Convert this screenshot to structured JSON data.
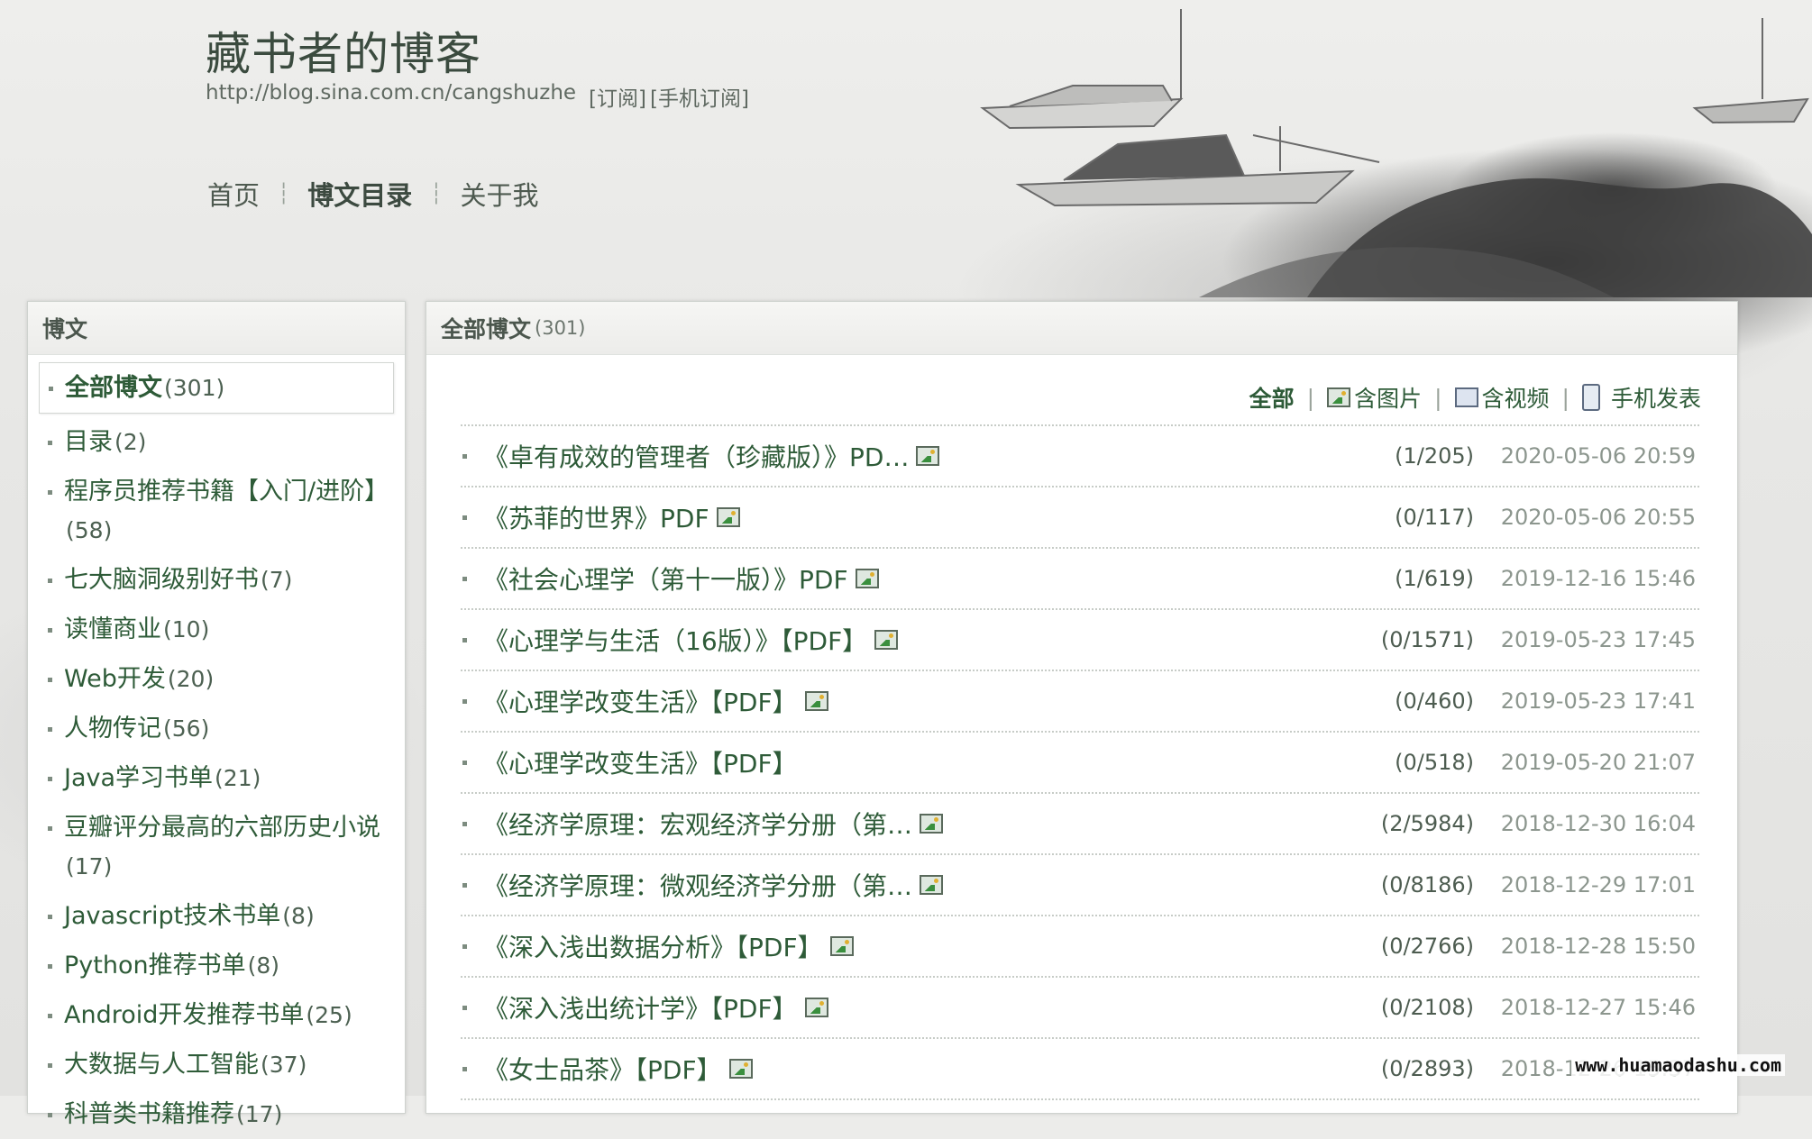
{
  "header": {
    "blog_title": "藏书者的博客",
    "url": "http://blog.sina.com.cn/cangshuzhe",
    "subscribe": "[订阅]",
    "mobile_subscribe": "[手机订阅]"
  },
  "nav": {
    "items": [
      "首页",
      "博文目录",
      "关于我"
    ],
    "active": "博文目录"
  },
  "sidebar": {
    "title": "博文",
    "categories": [
      {
        "name": "全部博文",
        "count": "(301)"
      },
      {
        "name": "目录",
        "count": "(2)"
      },
      {
        "name": "程序员推荐书籍【入门/进阶】",
        "count": "(58)"
      },
      {
        "name": "七大脑洞级别好书",
        "count": "(7)"
      },
      {
        "name": "读懂商业",
        "count": "(10)"
      },
      {
        "name": "Web开发",
        "count": "(20)"
      },
      {
        "name": "人物传记",
        "count": "(56)"
      },
      {
        "name": "Java学习书单",
        "count": "(21)"
      },
      {
        "name": "豆瓣评分最高的六部历史小说",
        "count": "(17)"
      },
      {
        "name": "Javascript技术书单",
        "count": "(8)"
      },
      {
        "name": "Python推荐书单",
        "count": "(8)"
      },
      {
        "name": "Android开发推荐书单",
        "count": "(25)"
      },
      {
        "name": "大数据与人工智能",
        "count": "(37)"
      },
      {
        "name": "科普类书籍推荐",
        "count": "(17)"
      }
    ]
  },
  "main": {
    "title": "全部博文",
    "count": "(301)",
    "filters": {
      "all": "全部",
      "with_images": "含图片",
      "with_video": "含视频",
      "mobile_posts": "手机发表"
    },
    "articles": [
      {
        "title": "《卓有成效的管理者（珍藏版）》PD…",
        "has_image": true,
        "stats": "(1/205)",
        "date": "2020-05-06 20:59"
      },
      {
        "title": "《苏菲的世界》PDF",
        "has_image": true,
        "stats": "(0/117)",
        "date": "2020-05-06 20:55"
      },
      {
        "title": "《社会心理学（第十一版）》PDF",
        "has_image": true,
        "stats": "(1/619)",
        "date": "2019-12-16 15:46"
      },
      {
        "title": "《心理学与生活（16版）》【PDF】",
        "has_image": true,
        "stats": "(0/1571)",
        "date": "2019-05-23 17:45"
      },
      {
        "title": "《心理学改变生活》【PDF】",
        "has_image": true,
        "stats": "(0/460)",
        "date": "2019-05-23 17:41"
      },
      {
        "title": "《心理学改变生活》【PDF】",
        "has_image": false,
        "stats": "(0/518)",
        "date": "2019-05-20 21:07"
      },
      {
        "title": "《经济学原理：宏观经济学分册（第…",
        "has_image": true,
        "stats": "(2/5984)",
        "date": "2018-12-30 16:04"
      },
      {
        "title": "《经济学原理：微观经济学分册（第…",
        "has_image": true,
        "stats": "(0/8186)",
        "date": "2018-12-29 17:01"
      },
      {
        "title": "《深入浅出数据分析》【PDF】",
        "has_image": true,
        "stats": "(0/2766)",
        "date": "2018-12-28 15:50"
      },
      {
        "title": "《深入浅出统计学》【PDF】",
        "has_image": true,
        "stats": "(0/2108)",
        "date": "2018-12-27 15:46"
      },
      {
        "title": "《女士品茶》【PDF】",
        "has_image": true,
        "stats": "(0/2893)",
        "date": "2018-12-26 15:37"
      }
    ]
  },
  "watermark": "www.huamaodashu.com",
  "colors": {
    "link_green": "#2e5b38",
    "date_gray": "#8c968e",
    "panel_border": "#cfd3cf"
  }
}
